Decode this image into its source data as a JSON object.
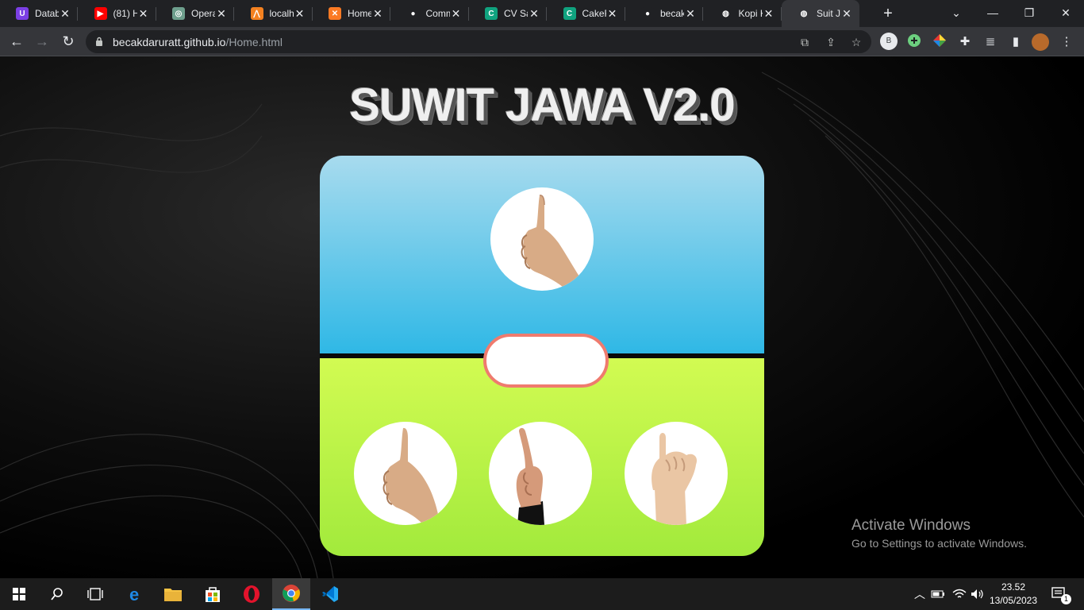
{
  "browser": {
    "tabs": [
      {
        "title": "Datab",
        "icon": "u-brand-icon",
        "color": "#7b3fe4",
        "glyph": "U"
      },
      {
        "title": "(81) H",
        "icon": "youtube-icon",
        "color": "#ff0000",
        "glyph": "▶"
      },
      {
        "title": "Operat",
        "icon": "openai-icon",
        "color": "#6e9f8d",
        "glyph": "◎"
      },
      {
        "title": "localh",
        "icon": "xampp-icon",
        "color": "#f48120",
        "glyph": "⋀"
      },
      {
        "title": "Home",
        "icon": "xampp-icon",
        "color": "#fb7a24",
        "glyph": "✕"
      },
      {
        "title": "Comm",
        "icon": "github-icon",
        "color": "#202124",
        "glyph": "●"
      },
      {
        "title": "CV Say",
        "icon": "c-brand-icon",
        "color": "#10a37f",
        "glyph": "C"
      },
      {
        "title": "CakeR",
        "icon": "c-brand-icon",
        "color": "#10a37f",
        "glyph": "C"
      },
      {
        "title": "becakd",
        "icon": "github-icon",
        "color": "#202124",
        "glyph": "●"
      },
      {
        "title": "Kopi K",
        "icon": "globe-icon",
        "color": "#202124",
        "glyph": "◍"
      },
      {
        "title": "Suit Ja",
        "icon": "globe-icon",
        "color": "#35363a",
        "glyph": "◍",
        "active": true
      }
    ],
    "url_host": "becakdaruratt.github.io",
    "url_path": "/Home.html",
    "profile_initial": "B"
  },
  "page": {
    "title": "SUWIT JAWA V2.0",
    "opponent_choice": "thumb-hand",
    "player_choices": [
      "thumb-hand",
      "index-finger-hand",
      "pinky-finger-hand"
    ],
    "result_text": "",
    "top_gradient": [
      "#a8dbee",
      "#2fb8e6"
    ],
    "bottom_gradient": [
      "#d2fb52",
      "#a2ea3c"
    ],
    "result_border": "#ef7b6e"
  },
  "watermark": {
    "line1": "Activate Windows",
    "line2": "Go to Settings to activate Windows."
  },
  "taskbar": {
    "time": "23.52",
    "date": "13/05/2023",
    "notification_count": "1"
  }
}
